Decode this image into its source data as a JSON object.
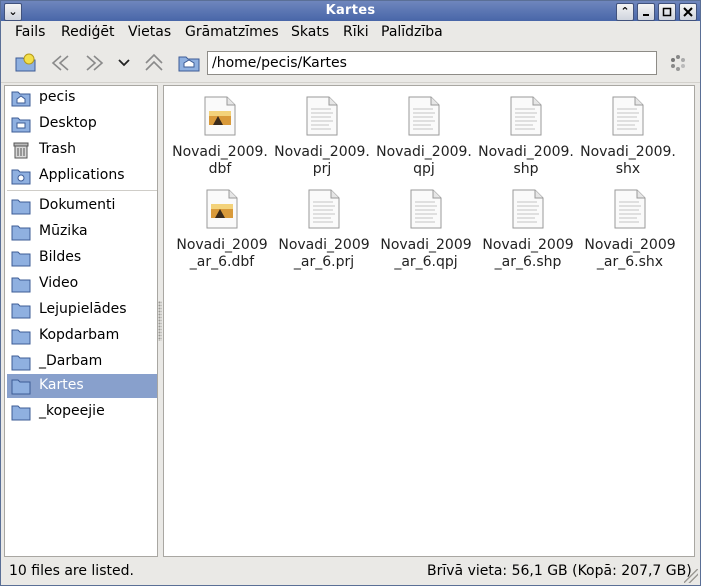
{
  "window": {
    "title": "Kartes"
  },
  "menubar": [
    "Fails",
    "Rediģēt",
    "Vietas",
    "Grāmatzīmes",
    "Skats",
    "Rīki",
    "Palīdzība"
  ],
  "location": {
    "path": "/home/pecis/Kartes"
  },
  "sidebar": {
    "places": [
      {
        "label": "pecis",
        "icon": "home-folder-icon"
      },
      {
        "label": "Desktop",
        "icon": "desktop-icon"
      },
      {
        "label": "Trash",
        "icon": "trash-icon"
      },
      {
        "label": "Applications",
        "icon": "applications-icon"
      }
    ],
    "bookmarks": [
      {
        "label": "Dokumenti",
        "icon": "folder-icon"
      },
      {
        "label": "Mūzika",
        "icon": "folder-icon"
      },
      {
        "label": "Bildes",
        "icon": "folder-icon"
      },
      {
        "label": "Video",
        "icon": "folder-icon"
      },
      {
        "label": "Lejupielādes",
        "icon": "folder-icon"
      },
      {
        "label": "Kopdarbam",
        "icon": "folder-icon"
      },
      {
        "label": "_Darbam",
        "icon": "folder-icon"
      },
      {
        "label": "Kartes",
        "icon": "folder-icon",
        "selected": true
      },
      {
        "label": "_kopeejie",
        "icon": "folder-icon"
      }
    ]
  },
  "files": [
    {
      "line1": "Novadi_2009.",
      "line2": "dbf",
      "icon": "spreadsheet-image-icon"
    },
    {
      "line1": "Novadi_2009.",
      "line2": "prj",
      "icon": "text-file-icon"
    },
    {
      "line1": "Novadi_2009.",
      "line2": "qpj",
      "icon": "text-file-icon"
    },
    {
      "line1": "Novadi_2009.",
      "line2": "shp",
      "icon": "text-file-icon"
    },
    {
      "line1": "Novadi_2009.",
      "line2": "shx",
      "icon": "text-file-icon"
    },
    {
      "line1": "Novadi_2009",
      "line2": "_ar_6.dbf",
      "icon": "spreadsheet-image-icon"
    },
    {
      "line1": "Novadi_2009",
      "line2": "_ar_6.prj",
      "icon": "text-file-icon"
    },
    {
      "line1": "Novadi_2009",
      "line2": "_ar_6.qpj",
      "icon": "text-file-icon"
    },
    {
      "line1": "Novadi_2009",
      "line2": "_ar_6.shp",
      "icon": "text-file-icon"
    },
    {
      "line1": "Novadi_2009",
      "line2": "_ar_6.shx",
      "icon": "text-file-icon"
    }
  ],
  "status": {
    "count": "10 files are listed.",
    "space": "Brīvā vieta: 56,1 GB (Kopā: 207,7 GB)"
  },
  "colors": {
    "titlebar": "#4866a8",
    "selection": "#88a0cc"
  }
}
